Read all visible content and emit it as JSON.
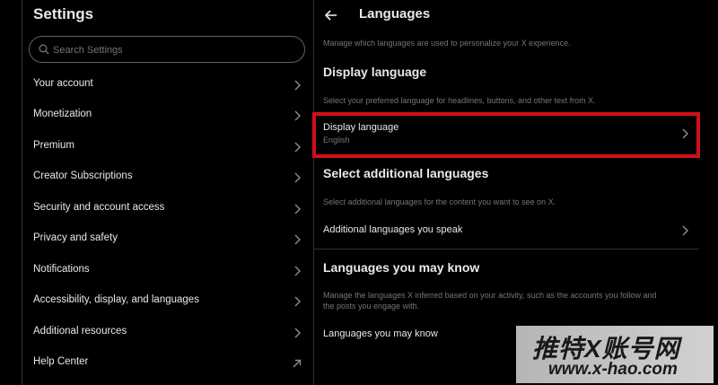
{
  "sidebar": {
    "title": "Settings",
    "search": {
      "placeholder": "Search Settings",
      "value": ""
    },
    "items": [
      {
        "label": "Your account",
        "icon": "chevron-right-icon"
      },
      {
        "label": "Monetization",
        "icon": "chevron-right-icon"
      },
      {
        "label": "Premium",
        "icon": "chevron-right-icon"
      },
      {
        "label": "Creator Subscriptions",
        "icon": "chevron-right-icon"
      },
      {
        "label": "Security and account access",
        "icon": "chevron-right-icon"
      },
      {
        "label": "Privacy and safety",
        "icon": "chevron-right-icon"
      },
      {
        "label": "Notifications",
        "icon": "chevron-right-icon"
      },
      {
        "label": "Accessibility, display, and languages",
        "icon": "chevron-right-icon"
      },
      {
        "label": "Additional resources",
        "icon": "chevron-right-icon"
      },
      {
        "label": "Help Center",
        "icon": "external-link-arrow-icon"
      }
    ]
  },
  "detail": {
    "title": "Languages",
    "intro": "Manage which languages are used to personalize your X experience.",
    "display_section": {
      "heading": "Display language",
      "description": "Select your preferred language for headlines, buttons, and other text from X.",
      "row_label": "Display language",
      "row_value": "English"
    },
    "additional_section": {
      "heading": "Select additional languages",
      "description": "Select additional languages for the content you want to see on X.",
      "row_label": "Additional languages you speak"
    },
    "may_know_section": {
      "heading": "Languages you may know",
      "description_line1": "Manage the languages X inferred based on your activity, such as the accounts you follow and",
      "description_line2": "the posts you engage with.",
      "row_label": "Languages you may know"
    }
  },
  "watermark": {
    "line1": "推特X账号网",
    "line2": "www.x-hao.com"
  },
  "colors": {
    "background": "#000000",
    "text": "#e7e9ea",
    "muted": "#71767b",
    "border": "#2f3336",
    "highlight": "#d0101a"
  }
}
